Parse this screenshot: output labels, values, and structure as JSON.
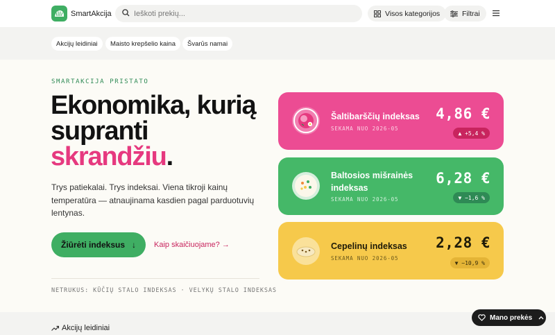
{
  "header": {
    "brand": "SmartAkcija",
    "search_placeholder": "Ieškoti prekių...",
    "categories_label": "Visos kategorijos",
    "filters_label": "Filtrai"
  },
  "chips": [
    "Akcijų leidiniai",
    "Maisto krepšelio kaina",
    "Švarūs namai"
  ],
  "hero": {
    "eyebrow": "SMARTAKCIJA PRISTATO",
    "headline_line1": "Ekonomika, kurią",
    "headline_line2": "supranti",
    "headline_accent": "skrandžiu",
    "headline_dot": ".",
    "lead": "Trys patiekalai. Trys indeksai. Viena tikroji kainų temperatūra — atnaujinama kasdien pagal parduotuvių lentynas.",
    "cta_label": "Žiūrėti indeksus",
    "cta_arrow": "↓",
    "how_label": "Kaip skaičiuojame? →",
    "soon": "NETRUKUS: KŪČIŲ STALO INDEKSAS · VELYKŲ STALO INDEKSAS"
  },
  "indices": [
    {
      "name": "Šaltibarščių indeksas",
      "since": "SEKAMA NUO 2026-05",
      "price": "4,86 €",
      "delta": "▲ +5,4 %",
      "color": "#ec4c93",
      "icon": "cold-soup-icon"
    },
    {
      "name": "Baltosios mišrainės indeksas",
      "since": "SEKAMA NUO 2026-05",
      "price": "6,28 €",
      "delta": "▼ −1,6 %",
      "color": "#45b868",
      "icon": "salad-icon"
    },
    {
      "name": "Cepelinų indeksas",
      "since": "SEKAMA NUO 2026-05",
      "price": "2,28 €",
      "delta": "▼ −10,9 %",
      "color": "#f6c94b",
      "icon": "dumpling-icon"
    }
  ],
  "bottom": {
    "section_title": "Akcijų leidiniai",
    "my_items_label": "Mano prekės"
  }
}
